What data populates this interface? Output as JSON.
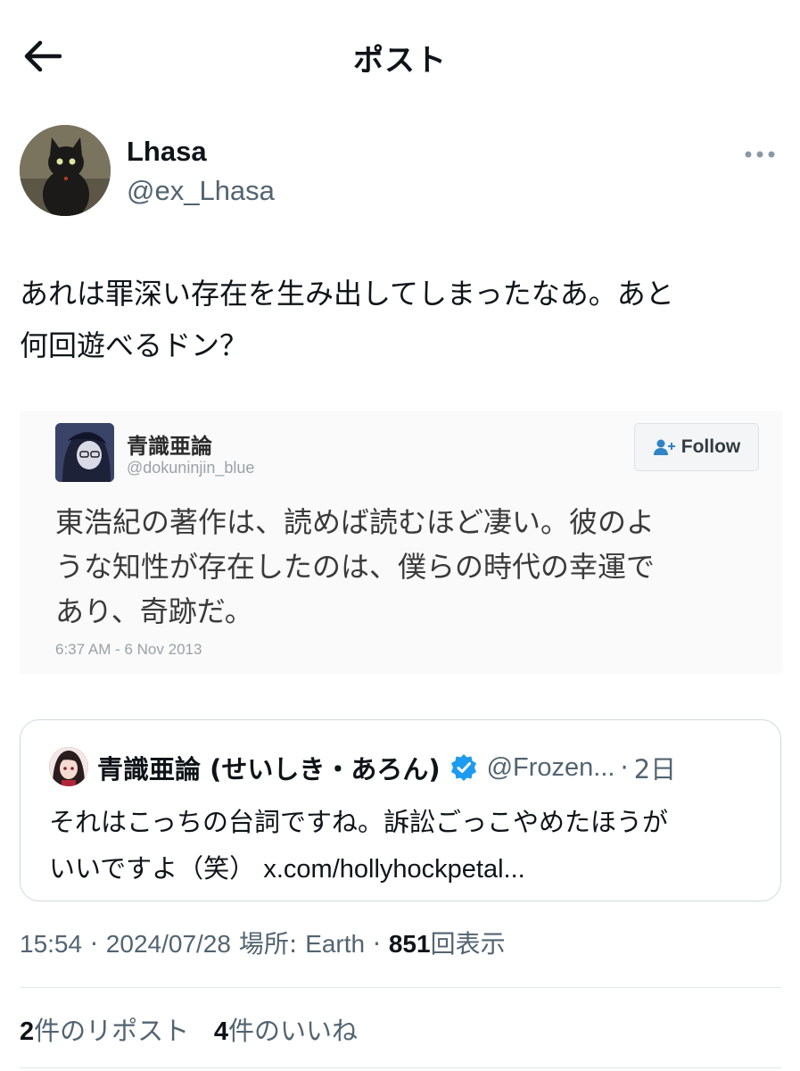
{
  "header": {
    "title": "ポスト",
    "back_icon": "arrow-left-icon"
  },
  "author": {
    "name": "Lhasa",
    "handle": "@ex_Lhasa",
    "more_icon": "more-horizontal-icon"
  },
  "post": {
    "text_line1": "あれは罪深い存在を生み出してしまったなあ。あと",
    "text_line2": "何回遊べるドン？"
  },
  "embedded_screenshot": {
    "name": "青識亜論",
    "handle": "@dokuninjin_blue",
    "follow_label": "Follow",
    "text_line1": "東浩紀の著作は、読めば読むほど凄い。彼のよ",
    "text_line2": "うな知性が存在したのは、僕らの時代の幸運で",
    "text_line3": "あり、奇跡だ。",
    "timestamp": "6:37 AM - 6 Nov 2013"
  },
  "quoted_post": {
    "name": "青識亜論 (せいしき・あろん)",
    "handle": "@Frozen...",
    "separator": "·",
    "age": "2日",
    "text_line1": "それはこっちの台詞ですね。訴訟ごっこやめたほうが",
    "text_line2_prefix": "いいですよ（笑）",
    "link": "x.com/hollyhockpetal...",
    "verified_color": "#1d9bf0"
  },
  "meta": {
    "time": "15:54",
    "date": "2024/07/28",
    "location_label": "場所:",
    "location": "Earth",
    "views_count": "851",
    "views_label": "回表示",
    "separator": "·"
  },
  "stats": {
    "reposts_count": "2",
    "reposts_label": "件のリポスト",
    "likes_count": "4",
    "likes_label": "件のいいね"
  },
  "colors": {
    "text_primary": "#0f1419",
    "text_secondary": "#536471",
    "border": "#cfd9de",
    "accent": "#1d9bf0"
  }
}
